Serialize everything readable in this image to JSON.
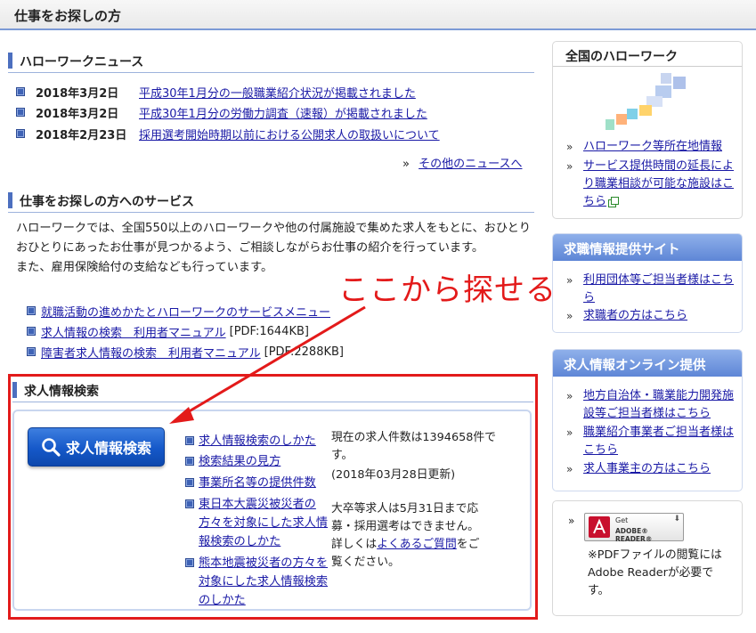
{
  "page": {
    "title": "仕事をお探しの方"
  },
  "news": {
    "heading": "ハローワークニュース",
    "items": [
      {
        "date": "2018年3月2日",
        "text": "平成30年1月分の一般職業紹介状況が掲載されました"
      },
      {
        "date": "2018年3月2日",
        "text": "平成30年1月分の労働力調査（速報）が掲載されました"
      },
      {
        "date": "2018年2月23日",
        "text": "採用選考開始時期以前における公開求人の取扱いについて"
      }
    ],
    "more_prefix": "»",
    "more": "その他のニュースへ"
  },
  "services": {
    "heading": "仕事をお探しの方へのサービス",
    "para1": "ハローワークでは、全国550以上のハローワークや他の付属施設で集めた求人をもとに、おひとりおひとりにあったお仕事が見つかるよう、ご相談しながらお仕事の紹介を行っています。",
    "para2": "また、雇用保険給付の支給なども行っています。",
    "links": [
      {
        "text": "就職活動の進めかたとハローワークのサービスメニュー",
        "suffix": ""
      },
      {
        "text": "求人情報の検索　利用者マニュアル",
        "suffix": "[PDF:1644KB]"
      },
      {
        "text": "障害者求人情報の検索　利用者マニュアル",
        "suffix": "[PDF:2288KB]"
      }
    ]
  },
  "callout": "ここから探せる",
  "job_search": {
    "heading": "求人情報検索",
    "button": "求人情報検索",
    "links": [
      "求人情報検索のしかた",
      "検索結果の見方",
      "事業所名等の提供件数",
      "東日本大震災被災者の方々を対象にした求人情報検索のしかた",
      "熊本地震被災者の方々を対象にした求人情報検索のしかた"
    ],
    "count_text": "現在の求人件数は1394658件です。",
    "updated": "(2018年03月28日更新)",
    "notice_pre": "大卒等求人は5月31日まで応募・採用選考はできません。詳しくは",
    "notice_link": "よくあるご質問",
    "notice_post": "をご覧ください。"
  },
  "sidebar": {
    "national": {
      "heading": "全国のハローワーク",
      "links": [
        "ハローワーク等所在地情報",
        "サービス提供時間の延長により職業相談が可能な施設はこちら"
      ]
    },
    "job_info_site": {
      "heading": "求職情報提供サイト",
      "links": [
        "利用団体等ご担当者様はこちら",
        "求職者の方はこちら"
      ]
    },
    "online": {
      "heading": "求人情報オンライン提供",
      "links": [
        "地方自治体・職業能力開発施設等ご担当者様はこちら",
        "職業紹介事業者ご担当者様はこちら",
        "求人事業主の方はこちら"
      ]
    },
    "adobe": {
      "badge_get": "Get",
      "badge_name": "ADOBE® READER®",
      "text": "※PDFファイルの閲覧にはAdobe Readerが必要です。"
    },
    "arrow": "»"
  },
  "colors": {
    "accent": "#4c6fbf",
    "callout": "#e31a1a",
    "link": "#1a1aa6"
  }
}
